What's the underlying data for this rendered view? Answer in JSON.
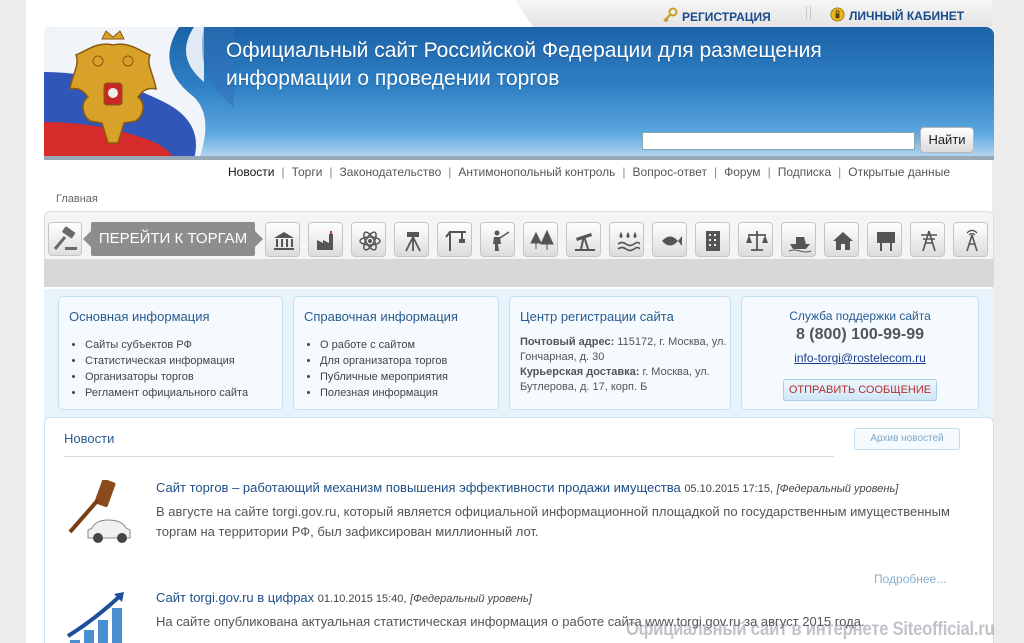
{
  "top": {
    "register_label": "Регистрация",
    "cabinet_label": "Личный кабинет"
  },
  "header": {
    "title": "Официальный сайт Российской Федерации для размещения информации о проведении торгов",
    "search_placeholder": "",
    "search_button": "Найти"
  },
  "nav": {
    "items": [
      "Новости",
      "Торги",
      "Законодательство",
      "Антимонопольный контроль",
      "Вопрос-ответ",
      "Форум",
      "Подписка",
      "Открытые данные"
    ]
  },
  "breadcrumb": "Главная",
  "categories": {
    "goto_label": "Перейти к торгам",
    "icons": [
      "bank-icon",
      "factory-icon",
      "atom-icon",
      "surveyor-icon",
      "crane-icon",
      "hunter-icon",
      "forest-icon",
      "oil-pump-icon",
      "water-icon",
      "fish-icon",
      "building-icon",
      "scales-icon",
      "boat-icon",
      "house-icon",
      "billboard-icon",
      "power-tower-icon",
      "radio-tower-icon"
    ]
  },
  "info": {
    "basic": {
      "title": "Основная информация",
      "items": [
        "Сайты субъектов РФ",
        "Статистическая информация",
        "Организаторы торгов",
        "Регламент официального сайта"
      ]
    },
    "reference": {
      "title": "Справочная информация",
      "items": [
        "О работе с сайтом",
        "Для организатора торгов",
        "Публичные мероприятия",
        "Полезная информация"
      ]
    },
    "registration": {
      "title": "Центр регистрации сайта",
      "postal_label": "Почтовый адрес:",
      "postal_value": " 115172, г. Москва, ул. Гончарная, д. 30",
      "courier_label": "Курьерская доставка:",
      "courier_value": " г. Москва, ул. Бутлерова, д. 17, корп. Б"
    },
    "support": {
      "title": "Служба поддержки сайта",
      "phone": "8 (800) 100-99-99",
      "email": "info-torgi@rostelecom.ru",
      "send_button": "Отправить сообщение"
    }
  },
  "news": {
    "title": "Новости",
    "archive_button": "Архив новостей",
    "items": [
      {
        "headline": "Сайт торгов – работающий механизм повышения эффективности продажи имущества",
        "date": "05.10.2015 17:15,",
        "level": "[Федеральный уровень]",
        "body": "В августе на сайте torgi.gov.ru, который является официальной информационной площадкой по государственным имущественным торгам на территории РФ, был зафиксирован миллионный лот.",
        "more": "Подробнее..."
      },
      {
        "headline": "Сайт torgi.gov.ru в цифрах",
        "date": "01.10.2015 15:40,",
        "level": "[Федеральный уровень]",
        "body": "На сайте опубликована актуальная статистическая информация о работе сайта www.torgi.gov.ru за август 2015 года."
      }
    ]
  },
  "watermark": "Официальный сайт в интернете Siteofficial.ru"
}
